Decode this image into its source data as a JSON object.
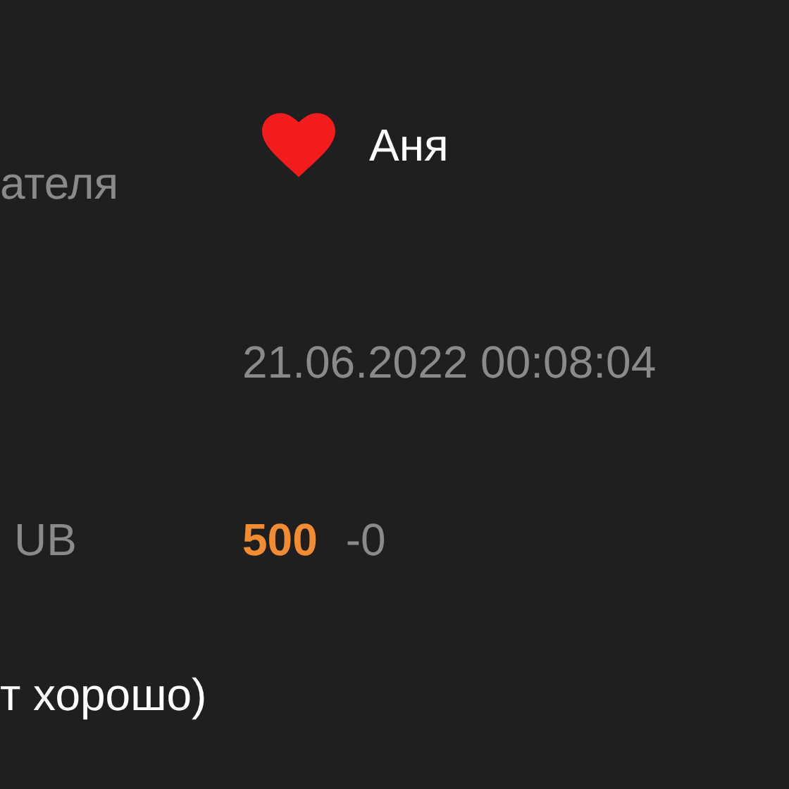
{
  "rows": [
    {
      "label": "ателя",
      "kind": "recipient",
      "value": "Аня"
    },
    {
      "kind": "date",
      "value": "21.06.2022 00:08:04"
    },
    {
      "label": "UB",
      "kind": "amount",
      "value": "500",
      "extra": "-0"
    }
  ],
  "comment": "т хорошо)"
}
